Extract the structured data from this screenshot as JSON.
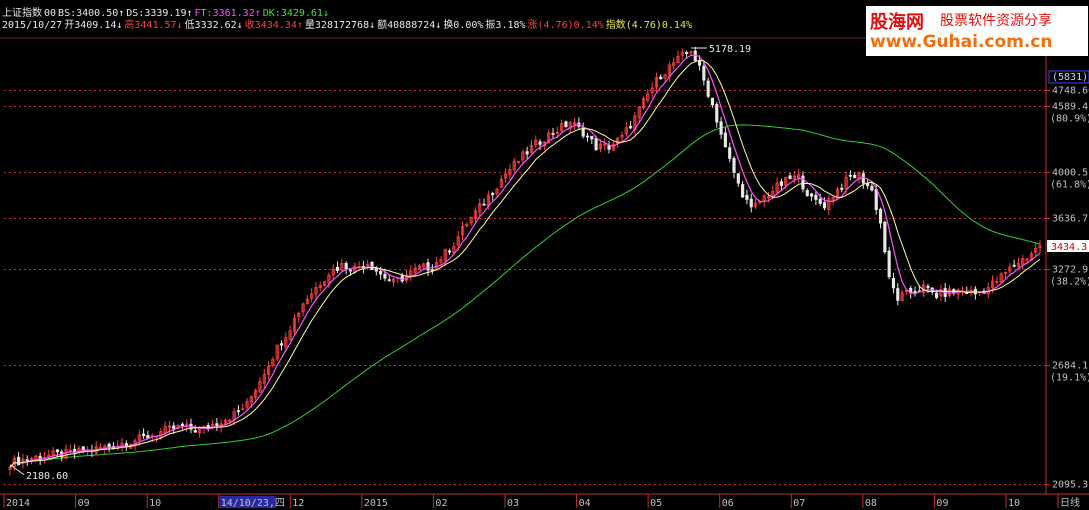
{
  "header": {
    "line1": [
      {
        "text": "上证指数",
        "color": "#e8e8e8"
      },
      {
        "text": "00",
        "color": "#e8e8e8"
      },
      {
        "text": "BS:3400.50↑",
        "color": "#e8e8e8"
      },
      {
        "text": "DS:3339.19↑",
        "color": "#e8e8e8"
      },
      {
        "text": "FT:3361.32↑",
        "color": "#ff50ff"
      },
      {
        "text": "DK:3429.61↓",
        "color": "#40e040"
      }
    ],
    "line2": [
      {
        "text": "2015/10/27",
        "color": "#e8e8e8"
      },
      {
        "text": "开3409.14↓",
        "color": "#e8e8e8"
      },
      {
        "text": "高3441.57↓",
        "color": "#ff4040"
      },
      {
        "text": "低3332.62↓",
        "color": "#e8e8e8"
      },
      {
        "text": "收3434.34↑",
        "color": "#ff4040"
      },
      {
        "text": "量328172768↓",
        "color": "#e8e8e8"
      },
      {
        "text": "额40888724↓",
        "color": "#e8e8e8"
      },
      {
        "text": "换0.00%",
        "color": "#e8e8e8"
      },
      {
        "text": "振3.18%",
        "color": "#e8e8e8"
      },
      {
        "text": "涨(4.76)0.14%",
        "color": "#ff4040"
      },
      {
        "text": "指数(4.76)0.14%",
        "color": "#e8e840"
      }
    ]
  },
  "watermark": {
    "site_cn": "股海网",
    "url": "www.Guhai.com.cn",
    "slogan": "股票软件资源分享"
  },
  "colors": {
    "background": "#000000",
    "up_candle": "#ff4040",
    "down_candle": "#e8e8e8",
    "ma_short": "#ff50ff",
    "ma_mid": "#ffffa0",
    "ma_long": "#30d030",
    "grid": "#c03030",
    "axis_text": "#c0c0c0"
  },
  "chart_data": {
    "type": "candlestick",
    "title": "上证指数",
    "date": "2015/10/27",
    "ylim": [
      2095.3,
      5178.19
    ],
    "y_scale": "log",
    "grid": true,
    "y_ticks": [
      {
        "value": 4748.66,
        "label": "4748.66",
        "pct": null
      },
      {
        "value": 4589.4,
        "label": "4589.4",
        "pct": "(80.9%)"
      },
      {
        "value": 4000.5,
        "label": "4000.5",
        "pct": "(61.8%)"
      },
      {
        "value": 3636.7,
        "label": "3636.7",
        "pct": null
      },
      {
        "value": 3272.9,
        "label": "3272.9",
        "pct": "(38.2%)"
      },
      {
        "value": 2684.1,
        "label": "2684.1",
        "pct": "(19.1%)"
      },
      {
        "value": 2095.3,
        "label": "2095.3",
        "pct": null
      }
    ],
    "y_top_label": "(5831)",
    "current_price_label": "3434.3",
    "annotations": {
      "high": {
        "label": "5178.19",
        "value": 5178.19
      },
      "low": {
        "label": "2180.60",
        "value": 2180.6
      }
    },
    "x_labels": [
      "2014",
      "09",
      "10",
      "14/10/23,四",
      "12",
      "2015",
      "02",
      "03",
      "04",
      "05",
      "06",
      "07",
      "08",
      "09",
      "10",
      "日线"
    ],
    "price_path": [
      [
        0,
        2190
      ],
      [
        6,
        2215
      ],
      [
        12,
        2230
      ],
      [
        18,
        2245
      ],
      [
        24,
        2270
      ],
      [
        30,
        2300
      ],
      [
        36,
        2340
      ],
      [
        40,
        2360
      ],
      [
        44,
        2340
      ],
      [
        48,
        2380
      ],
      [
        52,
        2420
      ],
      [
        55,
        2470
      ],
      [
        58,
        2600
      ],
      [
        62,
        2780
      ],
      [
        65,
        2900
      ],
      [
        68,
        3050
      ],
      [
        71,
        3150
      ],
      [
        74,
        3250
      ],
      [
        77,
        3300
      ],
      [
        80,
        3280
      ],
      [
        83,
        3320
      ],
      [
        86,
        3240
      ],
      [
        89,
        3180
      ],
      [
        92,
        3230
      ],
      [
        95,
        3280
      ],
      [
        98,
        3290
      ],
      [
        100,
        3350
      ],
      [
        103,
        3450
      ],
      [
        106,
        3600
      ],
      [
        109,
        3720
      ],
      [
        112,
        3850
      ],
      [
        115,
        3990
      ],
      [
        118,
        4100
      ],
      [
        121,
        4210
      ],
      [
        124,
        4300
      ],
      [
        127,
        4370
      ],
      [
        130,
        4440
      ],
      [
        133,
        4350
      ],
      [
        136,
        4220
      ],
      [
        139,
        4220
      ],
      [
        142,
        4300
      ],
      [
        145,
        4480
      ],
      [
        148,
        4700
      ],
      [
        151,
        4900
      ],
      [
        154,
        5020
      ],
      [
        157,
        5120
      ],
      [
        158,
        5160
      ],
      [
        160,
        4960
      ],
      [
        163,
        4600
      ],
      [
        166,
        4200
      ],
      [
        169,
        3900
      ],
      [
        172,
        3700
      ],
      [
        175,
        3800
      ],
      [
        178,
        3880
      ],
      [
        181,
        3950
      ],
      [
        183,
        3960
      ],
      [
        186,
        3780
      ],
      [
        189,
        3740
      ],
      [
        192,
        3860
      ],
      [
        195,
        3960
      ],
      [
        197,
        3980
      ],
      [
        200,
        3850
      ],
      [
        202,
        3600
      ],
      [
        204,
        3200
      ],
      [
        206,
        3080
      ],
      [
        209,
        3120
      ],
      [
        212,
        3150
      ],
      [
        215,
        3100
      ],
      [
        218,
        3120
      ],
      [
        221,
        3130
      ],
      [
        224,
        3110
      ],
      [
        227,
        3150
      ],
      [
        230,
        3220
      ],
      [
        233,
        3300
      ],
      [
        236,
        3360
      ],
      [
        239,
        3434.34
      ]
    ],
    "series": [
      {
        "name": "BS",
        "last": 3400.5
      },
      {
        "name": "DS",
        "last": 3339.19
      },
      {
        "name": "FT",
        "last": 3361.32
      },
      {
        "name": "DK",
        "last": 3429.61
      }
    ]
  }
}
